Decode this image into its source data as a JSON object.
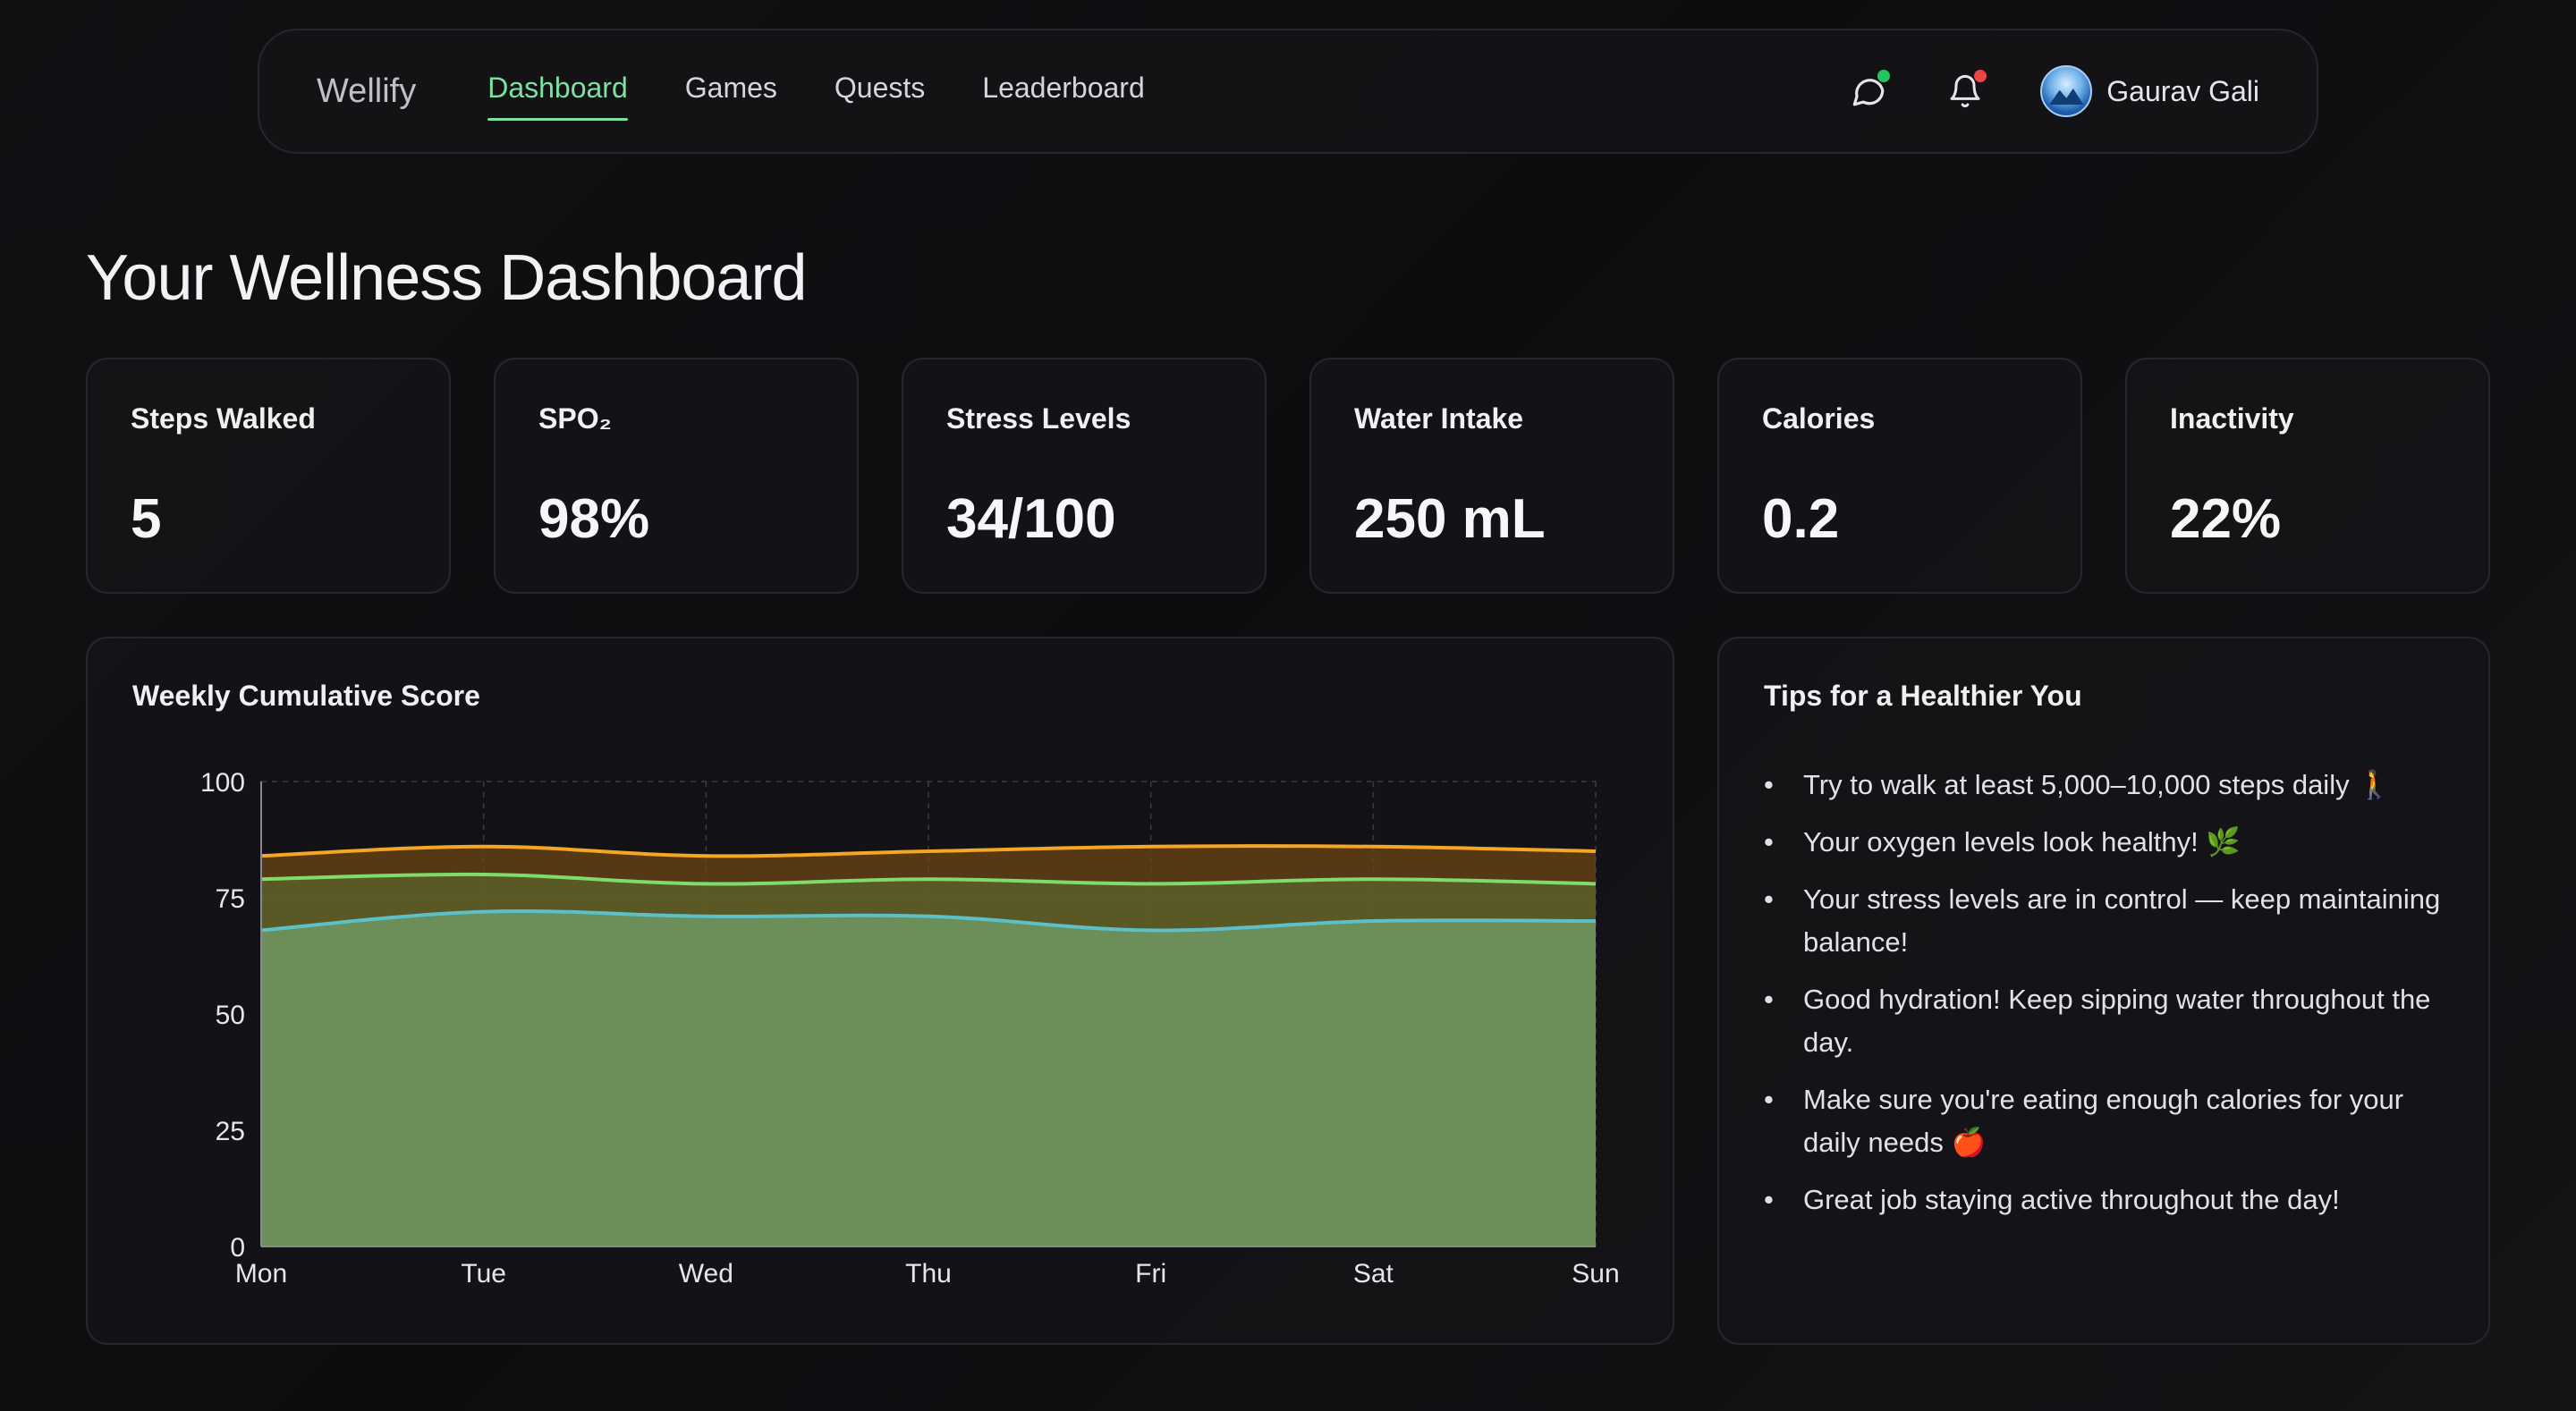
{
  "nav": {
    "brand": "Wellify",
    "links": [
      {
        "label": "Dashboard",
        "active": true
      },
      {
        "label": "Games",
        "active": false
      },
      {
        "label": "Quests",
        "active": false
      },
      {
        "label": "Leaderboard",
        "active": false
      }
    ],
    "chat_icon": "chat-bubble-icon",
    "bell_icon": "bell-icon",
    "chat_badge_color": "#22c55e",
    "bell_badge_color": "#ef4444",
    "user_name": "Gaurav Gali"
  },
  "page_title": "Your Wellness Dashboard",
  "stats": [
    {
      "label": "Steps Walked",
      "value": "5"
    },
    {
      "label": "SPO₂",
      "value": "98%"
    },
    {
      "label": "Stress Levels",
      "value": "34/100"
    },
    {
      "label": "Water Intake",
      "value": "250 mL"
    },
    {
      "label": "Calories",
      "value": "0.2"
    },
    {
      "label": "Inactivity",
      "value": "22%"
    }
  ],
  "chart_card_title": "Weekly Cumulative Score",
  "chart_data": {
    "type": "area",
    "title": "Weekly Cumulative Score",
    "categories": [
      "Mon",
      "Tue",
      "Wed",
      "Thu",
      "Fri",
      "Sat",
      "Sun"
    ],
    "ylim": [
      0,
      100
    ],
    "yticks": [
      0,
      25,
      50,
      75,
      100
    ],
    "grid": true,
    "series": [
      {
        "values": [
          68,
          72,
          71,
          71,
          68,
          70,
          70
        ],
        "color": "#5bc0c8"
      },
      {
        "values": [
          79,
          80,
          78,
          79,
          78,
          79,
          78
        ],
        "color": "#7ddc6a"
      },
      {
        "values": [
          84,
          86,
          84,
          85,
          86,
          86,
          85
        ],
        "color": "#f5a623"
      }
    ]
  },
  "tips_title": "Tips for a Healthier You",
  "tips": [
    "Try to walk at least 5,000–10,000 steps daily 🚶",
    "Your oxygen levels look healthy! 🌿",
    "Your stress levels are in control — keep maintaining balance!",
    "Good hydration! Keep sipping water throughout the day.",
    "Make sure you're eating enough calories for your daily needs 🍎",
    "Great job staying active throughout the day!"
  ]
}
